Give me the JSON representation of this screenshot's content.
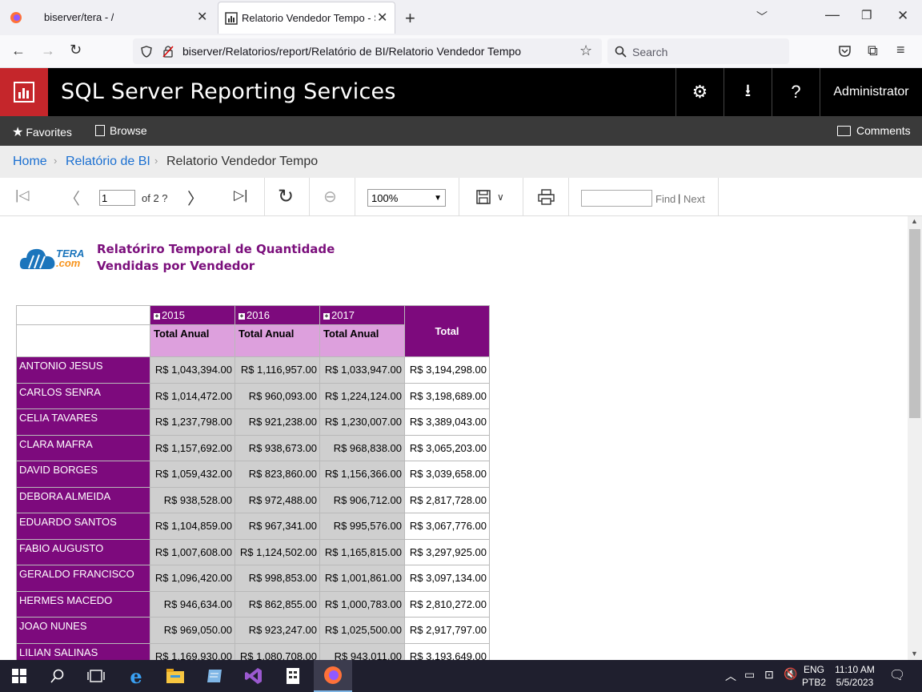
{
  "browser": {
    "tabs": [
      {
        "title": "biserver/tera - /"
      },
      {
        "title": "Relatorio Vendedor Tempo - SQL"
      }
    ],
    "url": "biserver/Relatorios/report/Relatório de BI/Relatorio Vendedor Tempo",
    "search_placeholder": "Search"
  },
  "ssrs": {
    "title": "SQL Server Reporting Services",
    "user": "Administrator",
    "favorites": "Favorites",
    "browse": "Browse",
    "comments": "Comments"
  },
  "breadcrumb": {
    "home": "Home",
    "folder": "Relatório de BI",
    "current": "Relatorio Vendedor Tempo"
  },
  "toolbar": {
    "page_current": "1",
    "page_total": "of 2 ?",
    "zoom": "100%",
    "find": "Find",
    "sep": "|",
    "next": "Next"
  },
  "report": {
    "logo_line1": "TERA",
    "logo_line2": ".com",
    "title_line1": "Relatóriro Temporal de Quantidade",
    "title_line2": "Vendidas por Vendedor",
    "years": [
      "2015",
      "2016",
      "2017"
    ],
    "subheader": "Total Anual",
    "total_header": "Total",
    "rows": [
      {
        "name": "ANTONIO JESUS",
        "v": [
          "R$ 1,043,394.00",
          "R$ 1,116,957.00",
          "R$ 1,033,947.00"
        ],
        "total": "R$ 3,194,298.00"
      },
      {
        "name": "CARLOS SENRA",
        "v": [
          "R$ 1,014,472.00",
          "R$ 960,093.00",
          "R$ 1,224,124.00"
        ],
        "total": "R$ 3,198,689.00"
      },
      {
        "name": "CELIA TAVARES",
        "v": [
          "R$ 1,237,798.00",
          "R$ 921,238.00",
          "R$ 1,230,007.00"
        ],
        "total": "R$ 3,389,043.00"
      },
      {
        "name": "CLARA MAFRA",
        "v": [
          "R$ 1,157,692.00",
          "R$ 938,673.00",
          "R$ 968,838.00"
        ],
        "total": "R$ 3,065,203.00"
      },
      {
        "name": "DAVID BORGES",
        "v": [
          "R$ 1,059,432.00",
          "R$ 823,860.00",
          "R$ 1,156,366.00"
        ],
        "total": "R$ 3,039,658.00"
      },
      {
        "name": "DEBORA ALMEIDA",
        "v": [
          "R$ 938,528.00",
          "R$ 972,488.00",
          "R$ 906,712.00"
        ],
        "total": "R$ 2,817,728.00"
      },
      {
        "name": "EDUARDO SANTOS",
        "v": [
          "R$ 1,104,859.00",
          "R$ 967,341.00",
          "R$ 995,576.00"
        ],
        "total": "R$ 3,067,776.00"
      },
      {
        "name": "FABIO AUGUSTO",
        "v": [
          "R$ 1,007,608.00",
          "R$ 1,124,502.00",
          "R$ 1,165,815.00"
        ],
        "total": "R$ 3,297,925.00"
      },
      {
        "name": "GERALDO FRANCISCO",
        "v": [
          "R$ 1,096,420.00",
          "R$ 998,853.00",
          "R$ 1,001,861.00"
        ],
        "total": "R$ 3,097,134.00"
      },
      {
        "name": "HERMES MACEDO",
        "v": [
          "R$ 946,634.00",
          "R$ 862,855.00",
          "R$ 1,000,783.00"
        ],
        "total": "R$ 2,810,272.00"
      },
      {
        "name": "JOAO NUNES",
        "v": [
          "R$ 969,050.00",
          "R$ 923,247.00",
          "R$ 1,025,500.00"
        ],
        "total": "R$ 2,917,797.00"
      },
      {
        "name": "LILIAN SALINAS",
        "v": [
          "R$ 1,169,930.00",
          "R$ 1,080,708.00",
          "R$ 943,011.00"
        ],
        "total": "R$ 3,193,649.00"
      }
    ]
  },
  "taskbar": {
    "lang1": "ENG",
    "lang2": "PTB2",
    "time": "11:10 AM",
    "date": "5/5/2023"
  },
  "colors": {
    "accent_purple": "#7d0a7d",
    "light_purple": "#dda0dd",
    "ssrs_red": "#c5262b"
  }
}
